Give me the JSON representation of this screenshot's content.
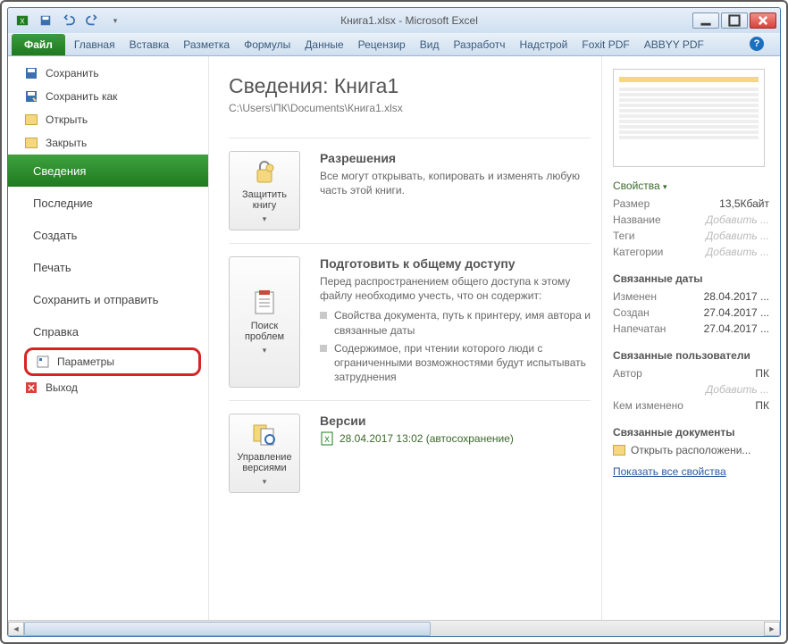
{
  "window": {
    "title": "Книга1.xlsx - Microsoft Excel"
  },
  "ribbon": {
    "tabs": [
      "Файл",
      "Главная",
      "Вставка",
      "Разметка",
      "Формулы",
      "Данные",
      "Рецензир",
      "Вид",
      "Разработч",
      "Надстрой",
      "Foxit PDF",
      "ABBYY PDF"
    ]
  },
  "sidebar": {
    "quick": [
      {
        "label": "Сохранить",
        "icon": "save-icon"
      },
      {
        "label": "Сохранить как",
        "icon": "save-as-icon"
      },
      {
        "label": "Открыть",
        "icon": "open-icon"
      },
      {
        "label": "Закрыть",
        "icon": "close-file-icon"
      }
    ],
    "pages": [
      {
        "label": "Сведения",
        "active": true
      },
      {
        "label": "Последние"
      },
      {
        "label": "Создать"
      },
      {
        "label": "Печать"
      },
      {
        "label": "Сохранить и отправить"
      },
      {
        "label": "Справка"
      }
    ],
    "options_label": "Параметры",
    "exit_label": "Выход"
  },
  "info": {
    "heading": "Сведения: Книга1",
    "path": "C:\\Users\\ПК\\Documents\\Книга1.xlsx",
    "protect": {
      "button": "Защитить книгу",
      "title": "Разрешения",
      "text": "Все могут открывать, копировать и изменять любую часть этой книги."
    },
    "inspect": {
      "button": "Поиск проблем",
      "title": "Подготовить к общему доступу",
      "text": "Перед распространением общего доступа к этому файлу необходимо учесть, что он содержит:",
      "bullets": [
        "Свойства документа, путь к принтеру, имя автора и связанные даты",
        "Содержимое, при чтении которого люди с ограниченными возможностями будут испытывать затруднения"
      ]
    },
    "versions": {
      "button": "Управление версиями",
      "title": "Версии",
      "line": "28.04.2017 13:02 (автосохранение)"
    }
  },
  "props": {
    "header": "Свойства",
    "rows": [
      {
        "k": "Размер",
        "v": "13,5Кбайт"
      },
      {
        "k": "Название",
        "v": "Добавить ...",
        "ph": true
      },
      {
        "k": "Теги",
        "v": "Добавить ...",
        "ph": true
      },
      {
        "k": "Категории",
        "v": "Добавить ...",
        "ph": true
      }
    ],
    "dates_header": "Связанные даты",
    "dates": [
      {
        "k": "Изменен",
        "v": "28.04.2017 ..."
      },
      {
        "k": "Создан",
        "v": "27.04.2017 ..."
      },
      {
        "k": "Напечатан",
        "v": "27.04.2017 ..."
      }
    ],
    "users_header": "Связанные пользователи",
    "users": [
      {
        "k": "Автор",
        "v": "ПК"
      },
      {
        "k": "",
        "v": "Добавить ...",
        "ph": true
      },
      {
        "k": "Кем изменено",
        "v": "ПК"
      }
    ],
    "docs_header": "Связанные документы",
    "open_location": "Открыть расположени...",
    "show_all": "Показать все свойства"
  }
}
